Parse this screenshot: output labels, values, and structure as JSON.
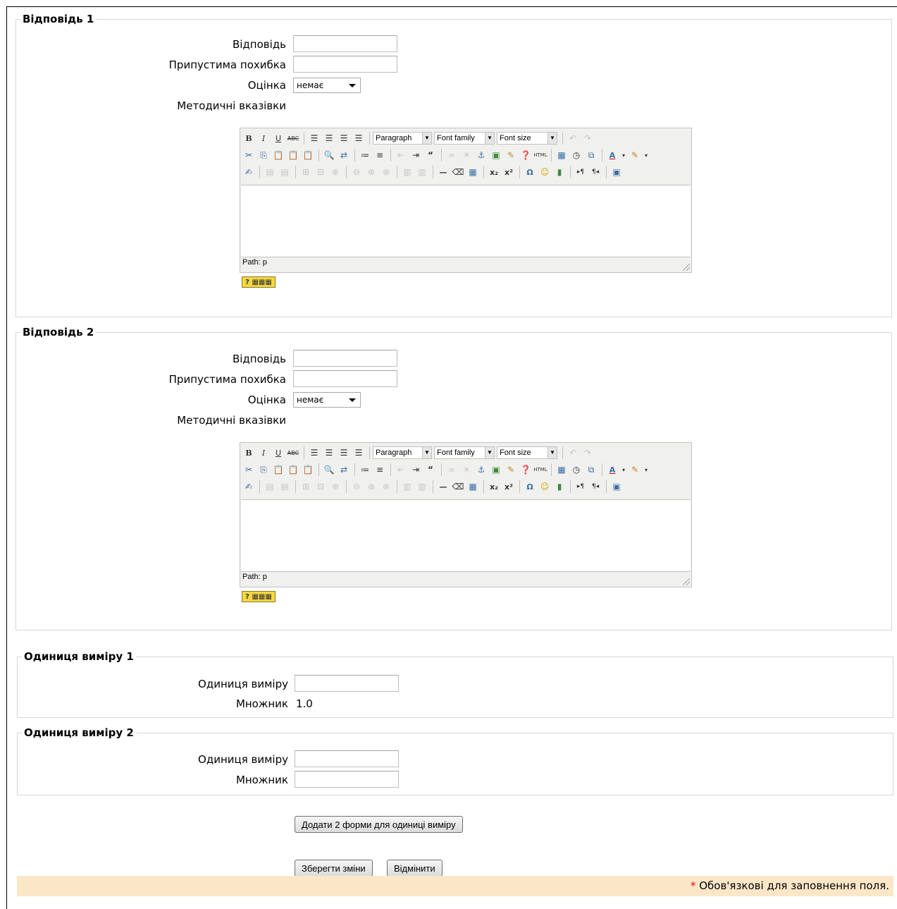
{
  "answers": [
    {
      "legend": "Відповідь 1",
      "answer_label": "Відповідь",
      "answer_value": "",
      "tolerance_label": "Припустима похибка",
      "tolerance_value": "",
      "grade_label": "Оцінка",
      "grade_value": "немає",
      "feedback_label": "Методичні вказівки",
      "editor": {
        "format_select": "Paragraph",
        "font_family_select": "Font family",
        "font_size_select": "Font size",
        "path_text": "Path: p"
      }
    },
    {
      "legend": "Відповідь 2",
      "answer_label": "Відповідь",
      "answer_value": "",
      "tolerance_label": "Припустима похибка",
      "tolerance_value": "",
      "grade_label": "Оцінка",
      "grade_value": "немає",
      "feedback_label": "Методичні вказівки",
      "editor": {
        "format_select": "Paragraph",
        "font_family_select": "Font family",
        "font_size_select": "Font size",
        "path_text": "Path: p"
      }
    }
  ],
  "units": [
    {
      "legend": "Одиниця виміру 1",
      "unit_label": "Одиниця виміру",
      "unit_value": "",
      "multiplier_label": "Множник",
      "multiplier_value": "1.0"
    },
    {
      "legend": "Одиниця виміру 2",
      "unit_label": "Одиниця виміру",
      "unit_value": "",
      "multiplier_label": "Множник",
      "multiplier_value": ""
    }
  ],
  "buttons": {
    "add_units": "Додати 2 форми для одиниці виміру",
    "save": "Зберегти зміни",
    "cancel": "Відмінити"
  },
  "required_note": {
    "star": "*",
    "text": "Обов'язкові для заповнення поля."
  },
  "colors": {
    "required_bar_bg": "#fbe7c8",
    "required_star": "#ff0000",
    "fieldset_border": "#d7d7d7"
  }
}
